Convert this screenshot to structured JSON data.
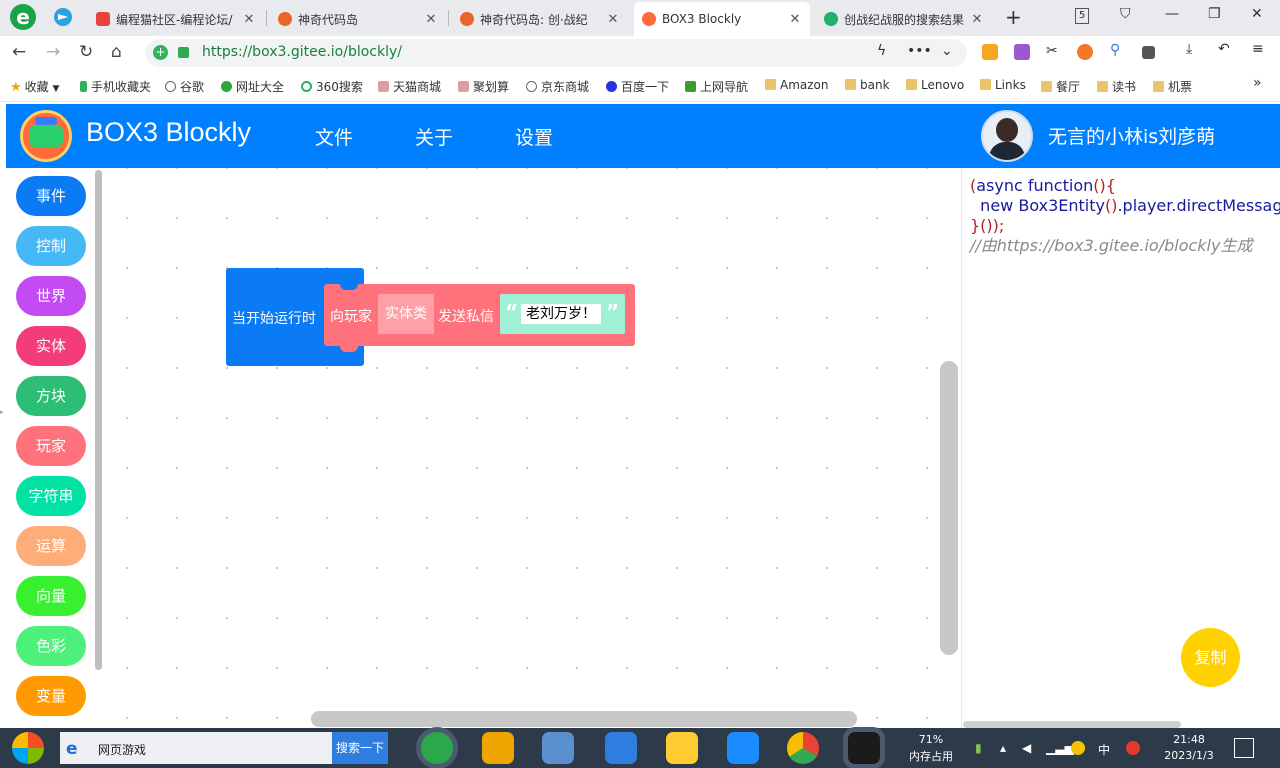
{
  "browser": {
    "tabs": [
      {
        "title": "编程猫社区-编程论坛/",
        "fav_color": "#e8423c"
      },
      {
        "title": "神奇代码岛",
        "fav_color": "#e8662a"
      },
      {
        "title": "神奇代码岛: 创·战纪",
        "fav_color": "#e8662a"
      },
      {
        "title": "BOX3 Blockly",
        "fav_color": "#ff6a3c"
      },
      {
        "title": "创战纪战服的搜索结果",
        "fav_color": "#21b067"
      }
    ],
    "tab_count": "5",
    "url": "https://box3.gitee.io/blockly/",
    "bookmarks": [
      {
        "label": "收藏",
        "icon": "star-icon"
      },
      {
        "label": "手机收藏夹",
        "icon": "phone-icon"
      },
      {
        "label": "谷歌",
        "icon": "globe-icon"
      },
      {
        "label": "网址大全",
        "icon": "site-icon"
      },
      {
        "label": "360搜索",
        "icon": "search-icon"
      },
      {
        "label": "天猫商城",
        "icon": "grid-icon"
      },
      {
        "label": "聚划算",
        "icon": "grid-icon"
      },
      {
        "label": "京东商城",
        "icon": "globe-icon"
      },
      {
        "label": "百度一下",
        "icon": "paw-icon"
      },
      {
        "label": "上网导航",
        "icon": "hao-icon"
      },
      {
        "label": "Amazon",
        "icon": "folder-icon"
      },
      {
        "label": "bank",
        "icon": "folder-icon"
      },
      {
        "label": "Lenovo",
        "icon": "folder-icon"
      },
      {
        "label": "Links",
        "icon": "folder-icon"
      },
      {
        "label": "餐厅",
        "icon": "folder-icon"
      },
      {
        "label": "读书",
        "icon": "folder-icon"
      },
      {
        "label": "机票",
        "icon": "folder-icon"
      }
    ],
    "bookmarks_more": "»"
  },
  "app": {
    "title": "BOX3 Blockly",
    "menu": [
      "文件",
      "关于",
      "设置"
    ],
    "username": "无言的小林is刘彦萌"
  },
  "toolbox": {
    "categories": [
      {
        "label": "事件",
        "color": "#0a7af5"
      },
      {
        "label": "控制",
        "color": "#45b8f5"
      },
      {
        "label": "世界",
        "color": "#c24cf2"
      },
      {
        "label": "实体",
        "color": "#f23d7a"
      },
      {
        "label": "方块",
        "color": "#2dbd74"
      },
      {
        "label": "玩家",
        "color": "#ff727c"
      },
      {
        "label": "字符串",
        "color": "#00e2a4"
      },
      {
        "label": "运算",
        "color": "#ffad78"
      },
      {
        "label": "向量",
        "color": "#38f030"
      },
      {
        "label": "色彩",
        "color": "#4cf07a"
      },
      {
        "label": "变量",
        "color": "#ff9a00"
      }
    ]
  },
  "workspace": {
    "hat_block": {
      "label": "当开始运行时",
      "color": "#0a7af5"
    },
    "command_block": {
      "prefix": "向玩家",
      "entity_slot": "实体类",
      "action": "发送私信",
      "open_quote": "“",
      "message": "老刘万岁！",
      "close_quote": "”",
      "color": "#ff727c"
    }
  },
  "code": {
    "line1_paren": "(",
    "line1_kw": "async function",
    "line1_tail": "(){",
    "line2_kw": "new",
    "line2_cls": "Box3Entity",
    "line2_call": "()",
    "line2_rest": ".player.directMessag",
    "line3": "}());",
    "line4": "//由https://box3.gitee.io/blockly生成",
    "copy_label": "复制"
  },
  "taskbar": {
    "search_text": "网页游戏",
    "search_button": "搜索一下",
    "memory_percent": "71%",
    "memory_label": "内存占用",
    "ime_label": "中",
    "time": "21:48",
    "date": "2023/1/3"
  }
}
